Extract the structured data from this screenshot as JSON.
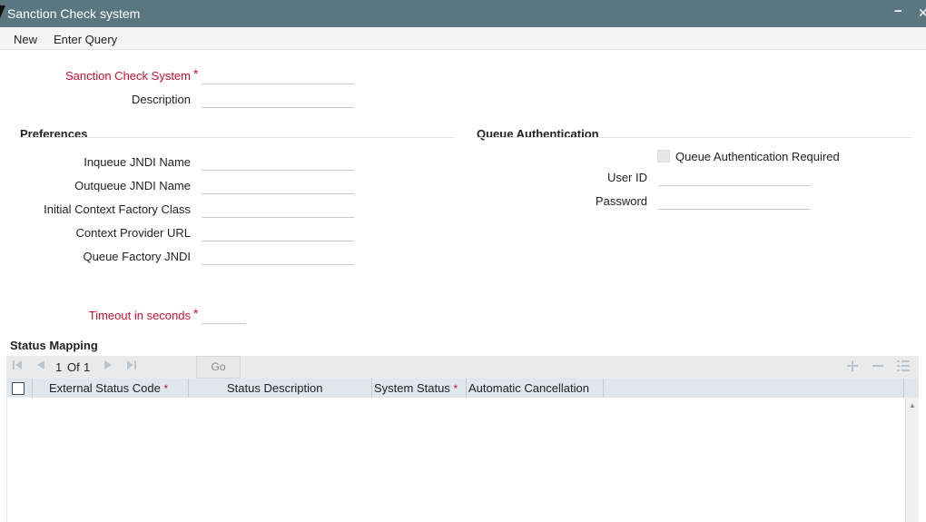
{
  "window": {
    "title": "Sanction Check system",
    "minimize": "−",
    "close": "✕"
  },
  "menu": {
    "new": "New",
    "enter_query": "Enter Query"
  },
  "header_fields": {
    "sanction_check_system": {
      "label": "Sanction Check System",
      "value": ""
    },
    "description": {
      "label": "Description",
      "value": ""
    }
  },
  "preferences": {
    "title": "Preferences",
    "inqueue_jndi": {
      "label": "Inqueue JNDI Name",
      "value": ""
    },
    "outqueue_jndi": {
      "label": "Outqueue JNDI Name",
      "value": ""
    },
    "initial_context_factory": {
      "label": "Initial Context Factory Class",
      "value": ""
    },
    "context_provider_url": {
      "label": "Context Provider URL",
      "value": ""
    },
    "queue_factory_jndi": {
      "label": "Queue Factory JNDI",
      "value": ""
    }
  },
  "queue_auth": {
    "title": "Queue Authentication",
    "required_label": "Queue Authentication Required",
    "required_checked": false,
    "user_id": {
      "label": "User ID",
      "value": ""
    },
    "password": {
      "label": "Password",
      "value": ""
    }
  },
  "timeout": {
    "label": "Timeout in seconds",
    "value": ""
  },
  "required_marker": "*",
  "status_mapping": {
    "title": "Status Mapping",
    "pager": {
      "current": "1",
      "of_label": "Of",
      "total": "1"
    },
    "go_label": "Go",
    "columns": [
      {
        "label": "External Status Code",
        "required": true
      },
      {
        "label": "Status Description",
        "required": false
      },
      {
        "label": "System Status",
        "required": true
      },
      {
        "label": "Automatic Cancellation",
        "required": false
      }
    ],
    "rows": []
  },
  "icons": {
    "first": "first-page-icon",
    "prev": "previous-page-icon",
    "next": "next-page-icon",
    "last": "last-page-icon",
    "add": "add-row-icon",
    "delete": "delete-row-icon",
    "view": "view-details-icon"
  },
  "colors": {
    "titlebar": "#5a7680",
    "required": "#c8102e",
    "grid_header": "#dfe6ec",
    "toolbar_icon": "#b8c6d2"
  }
}
